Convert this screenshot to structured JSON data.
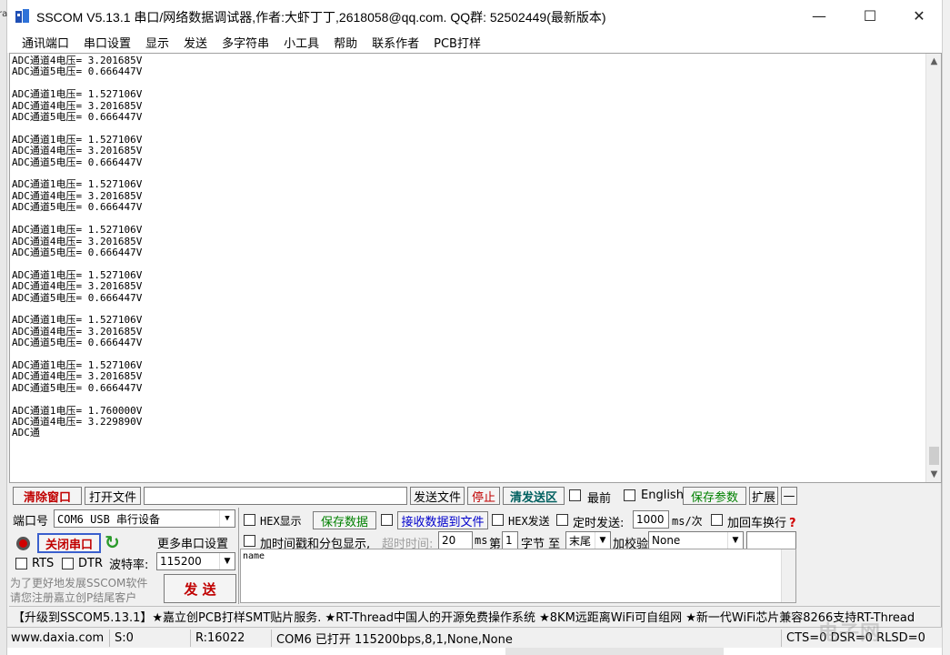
{
  "desktop": {
    "left_fragment": "ra"
  },
  "window": {
    "title": "SSCOM V5.13.1 串口/网络数据调试器,作者:大虾丁丁,2618058@qq.com. QQ群: 52502449(最新版本)",
    "controls": {
      "minimize": "—",
      "maximize": "☐",
      "close": "✕"
    }
  },
  "menu": [
    "通讯端口",
    "串口设置",
    "显示",
    "发送",
    "多字符串",
    "小工具",
    "帮助",
    "联系作者",
    "PCB打样"
  ],
  "receive": {
    "text": "ADC通道4电压= 3.201685V\nADC通道5电压= 0.666447V\n\nADC通道1电压= 1.527106V\nADC通道4电压= 3.201685V\nADC通道5电压= 0.666447V\n\nADC通道1电压= 1.527106V\nADC通道4电压= 3.201685V\nADC通道5电压= 0.666447V\n\nADC通道1电压= 1.527106V\nADC通道4电压= 3.201685V\nADC通道5电压= 0.666447V\n\nADC通道1电压= 1.527106V\nADC通道4电压= 3.201685V\nADC通道5电压= 0.666447V\n\nADC通道1电压= 1.527106V\nADC通道4电压= 3.201685V\nADC通道5电压= 0.666447V\n\nADC通道1电压= 1.527106V\nADC通道4电压= 3.201685V\nADC通道5电压= 0.666447V\n\nADC通道1电压= 1.527106V\nADC通道4电压= 3.201685V\nADC通道5电压= 0.666447V\n\nADC通道1电压= 1.760000V\nADC通道4电压= 3.229890V\nADC通"
  },
  "toolbar1": {
    "clear_window": "清除窗口",
    "open_file": "打开文件",
    "file_path": "",
    "send_file": "发送文件",
    "stop": "停止",
    "clear_send": "清发送区",
    "topmost": "最前",
    "english": "English",
    "save_params": "保存参数",
    "expand": "扩展",
    "collapse": "—"
  },
  "port": {
    "label": "端口号",
    "value": "COM6 USB 串行设备",
    "close_port": "关闭串口",
    "more_settings": "更多串口设置",
    "rts": "RTS",
    "dtr": "DTR",
    "baud_label": "波特率:",
    "baud_value": "115200"
  },
  "options": {
    "hex_display": "HEX显示",
    "save_data": "保存数据",
    "recv_to_file": "接收数据到文件",
    "hex_send": "HEX发送",
    "timed_send": "定时发送:",
    "interval": "1000",
    "interval_unit": "ms/次",
    "add_crlf": "加回车换行",
    "add_timestamp": "加时间戳和分包显示,",
    "timeout_label": "超时时间:",
    "timeout_value": "20",
    "timeout_unit": "ms",
    "byte_prefix": "第",
    "byte_index": "1",
    "byte_suffix": "字节 至",
    "byte_end": "末尾",
    "checksum_label": "加校验",
    "checksum_value": "None"
  },
  "send": {
    "text": "name",
    "button": "发 送",
    "promo1": "为了更好地发展SSCOM软件",
    "promo2": "请您注册嘉立创P结尾客户"
  },
  "ad": "【升级到SSCOM5.13.1】★嘉立创PCB打样SMT贴片服务. ★RT-Thread中国人的开源免费操作系统 ★8KM远距离WiFi可自组网 ★新一代WiFi芯片兼容8266支持RT-Thread",
  "status": {
    "site": "www.daxia.com",
    "sent": "S:0",
    "received": "R:16022",
    "port_state": "COM6 已打开  115200bps,8,1,None,None",
    "lines": "CTS=0 DSR=0 RLSD=0"
  },
  "watermark": "电子网",
  "colors": {
    "accent_red": "#c00000",
    "accent_green": "#008000",
    "accent_blue": "#0000cc"
  }
}
